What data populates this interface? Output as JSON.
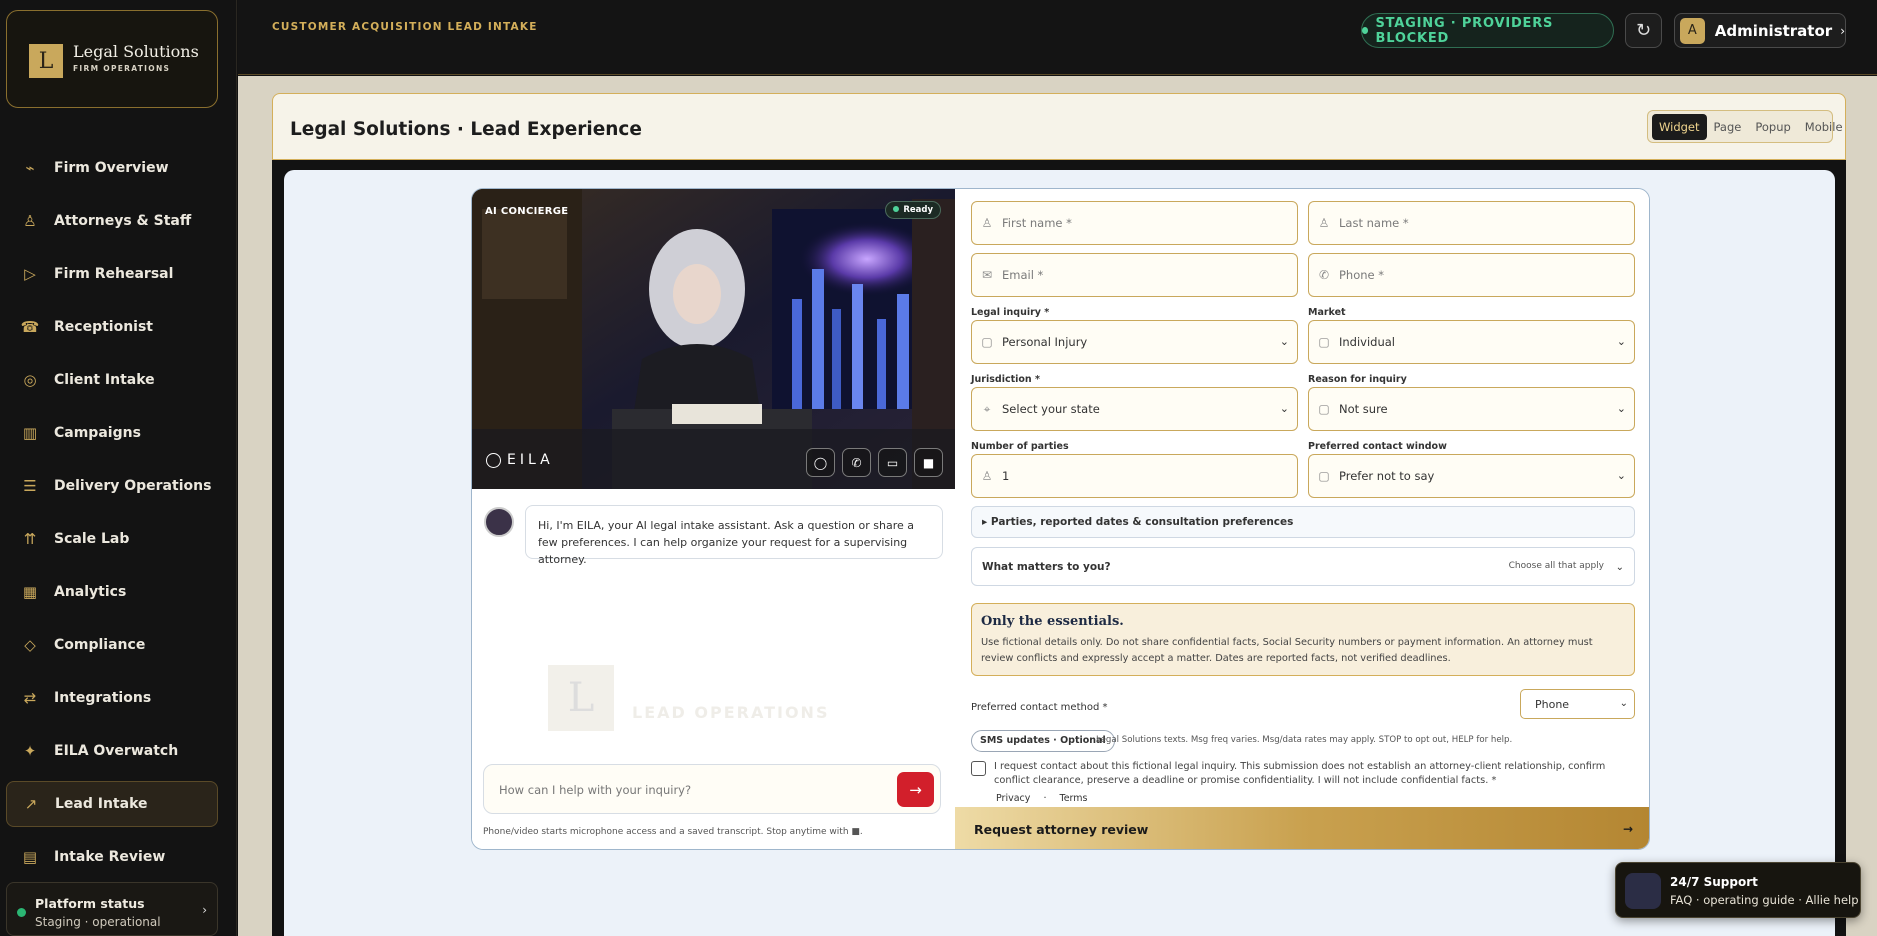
{
  "brand": {
    "mark": "L",
    "title": "Legal Solutions",
    "subtitle": "FIRM OPERATIONS"
  },
  "sidebar": {
    "items": [
      {
        "label": "Firm Overview",
        "icon": "trend-icon"
      },
      {
        "label": "Attorneys & Staff",
        "icon": "person-icon"
      },
      {
        "label": "Firm Rehearsal",
        "icon": "play-icon"
      },
      {
        "label": "Receptionist",
        "icon": "phone-icon"
      },
      {
        "label": "Client Intake",
        "icon": "intake-icon"
      },
      {
        "label": "Campaigns",
        "icon": "columns-icon"
      },
      {
        "label": "Delivery Operations",
        "icon": "list-icon"
      },
      {
        "label": "Scale Lab",
        "icon": "scale-icon"
      },
      {
        "label": "Analytics",
        "icon": "bars-icon"
      },
      {
        "label": "Compliance",
        "icon": "diamond-icon"
      },
      {
        "label": "Integrations",
        "icon": "swap-icon"
      },
      {
        "label": "EILA Overwatch",
        "icon": "sparkle-icon"
      },
      {
        "label": "Lead Intake",
        "icon": "arrow-icon"
      },
      {
        "label": "Intake Review",
        "icon": "doc-icon"
      }
    ],
    "status": {
      "title": "Platform status",
      "subtitle": "Staging · operational"
    }
  },
  "topbar": {
    "title": "CUSTOMER ACQUISITION LEAD INTAKE",
    "staging": "STAGING · PROVIDERS BLOCKED",
    "refresh": "↻",
    "user": {
      "initial": "A",
      "name": "Administrator",
      "chevron": "›"
    }
  },
  "page": {
    "title": "Legal Solutions · Lead Experience",
    "modes": [
      "Widget",
      "Page",
      "Popup",
      "Mobile"
    ],
    "active_mode": "Widget"
  },
  "hero": {
    "badge": "AI CONCIERGE",
    "status": "Ready",
    "brand": "EILA"
  },
  "chat": {
    "greeting": "Hi, I'm EILA, your AI legal intake assistant. Ask a question or share a few preferences. I can help organize your request for a supervising attorney.",
    "watermark_mark": "L",
    "watermark_text": "LEAD OPERATIONS",
    "input_placeholder": "How can I help with your inquiry?",
    "send": "→",
    "note": "Phone/video starts microphone access and a saved transcript. Stop anytime with ■."
  },
  "form": {
    "first_name": "First name *",
    "last_name": "Last name *",
    "email": "Email *",
    "phone": "Phone *",
    "legal_inquiry": {
      "label": "Legal inquiry *",
      "value": "Personal Injury"
    },
    "market": {
      "label": "Market",
      "value": "Individual"
    },
    "jurisdiction": {
      "label": "Jurisdiction *",
      "value": "Select your state"
    },
    "reason": {
      "label": "Reason for inquiry",
      "value": "Not sure"
    },
    "parties": {
      "label": "Number of parties",
      "value": "1"
    },
    "contact_window": {
      "label": "Preferred contact window",
      "value": "Prefer not to say"
    },
    "accordion": "▸ Parties, reported dates & consultation preferences",
    "matters": {
      "title": "What matters to you?",
      "hint": "Choose all that apply"
    },
    "essentials": {
      "title": "Only the essentials.",
      "body": "Use fictional details only. Do not share confidential facts, Social Security numbers or payment information. An attorney must review conflicts and expressly accept a matter. Dates are reported facts, not verified deadlines."
    },
    "contact_method": {
      "label": "Preferred contact method *",
      "value": "Phone"
    },
    "sms": {
      "pill": "SMS updates · Optional",
      "note": "Legal Solutions texts. Msg freq varies. Msg/data rates may apply. STOP to opt out, HELP for help."
    },
    "consent": "I request contact about this fictional legal inquiry. This submission does not establish an attorney-client relationship, confirm conflict clearance, preserve a deadline or promise confidentiality. I will not include confidential facts. *",
    "links": {
      "privacy": "Privacy",
      "sep": "·",
      "terms": "Terms"
    },
    "submit": "Request attorney review",
    "submit_arrow": "→"
  },
  "support": {
    "title": "24/7 Support",
    "subtitle": "FAQ · operating guide · Allie help"
  },
  "colors": {
    "accent": "#c9a85c",
    "cta": "#d21f2b",
    "status_ok": "#2bb673"
  }
}
